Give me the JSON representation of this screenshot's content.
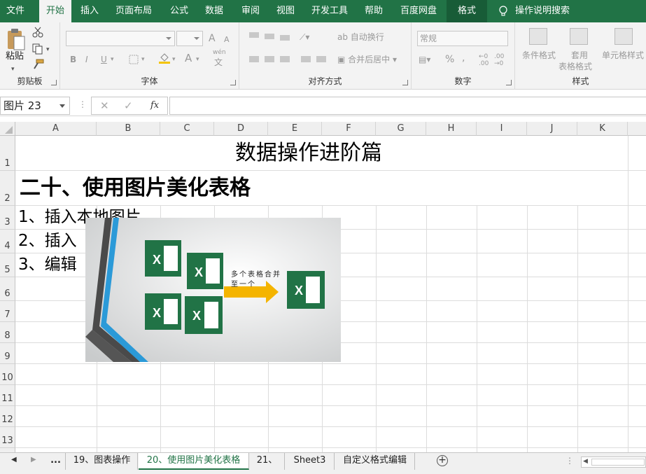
{
  "menu": {
    "tabs": [
      "文件",
      "开始",
      "插入",
      "页面布局",
      "公式",
      "数据",
      "审阅",
      "视图",
      "开发工具",
      "帮助",
      "百度网盘",
      "格式"
    ],
    "active": "开始",
    "search": "操作说明搜索"
  },
  "ribbon": {
    "clipboard": {
      "label": "剪贴板",
      "paste": "粘贴"
    },
    "font": {
      "label": "字体",
      "bold": "B",
      "italic": "I",
      "underline": "U",
      "grow": "A",
      "shrink": "A",
      "font_color": "A",
      "phonetic_top": "wén",
      "phonetic_bottom": "文"
    },
    "alignment": {
      "label": "对齐方式",
      "wrap": "自动换行",
      "merge": "合并后居中"
    },
    "number": {
      "label": "数字",
      "format": "常规",
      "percent": "%",
      "comma": ","
    },
    "styles": {
      "label": "样式",
      "conditional": "条件格式",
      "table_format_1": "套用",
      "table_format_2": "表格格式",
      "cell_styles": "单元格样式"
    }
  },
  "formula_bar": {
    "name_box": "图片 23",
    "cancel": "✕",
    "enter": "✓",
    "fx": "fx",
    "value": ""
  },
  "sheet": {
    "columns": [
      "A",
      "B",
      "C",
      "D",
      "E",
      "F",
      "G",
      "H",
      "I",
      "J",
      "K"
    ],
    "rows": [
      "1",
      "2",
      "3",
      "4",
      "5",
      "6",
      "7",
      "8",
      "9",
      "10",
      "11",
      "12",
      "13"
    ],
    "cells": {
      "title": "数据操作进阶篇",
      "heading": "二十、使用图片美化表格",
      "item1": "1、插入本地图片",
      "item2": "2、插入",
      "item3": "3、编辑"
    },
    "image": {
      "caption_line1": "多个表格合并",
      "caption_line2": "至一个",
      "icon_letter": "X"
    }
  },
  "sheet_tabs": {
    "nav_more": "...",
    "tabs": [
      "19、图表操作",
      "20、使用图片美化表格",
      "21、",
      "Sheet3",
      "自定义格式编辑"
    ],
    "active": "20、使用图片美化表格",
    "add": "+"
  },
  "colors": {
    "excel_green": "#217346",
    "dark_green": "#185c37",
    "arrow_orange": "#f4b400",
    "stripe_blue": "#2b9ad8"
  }
}
